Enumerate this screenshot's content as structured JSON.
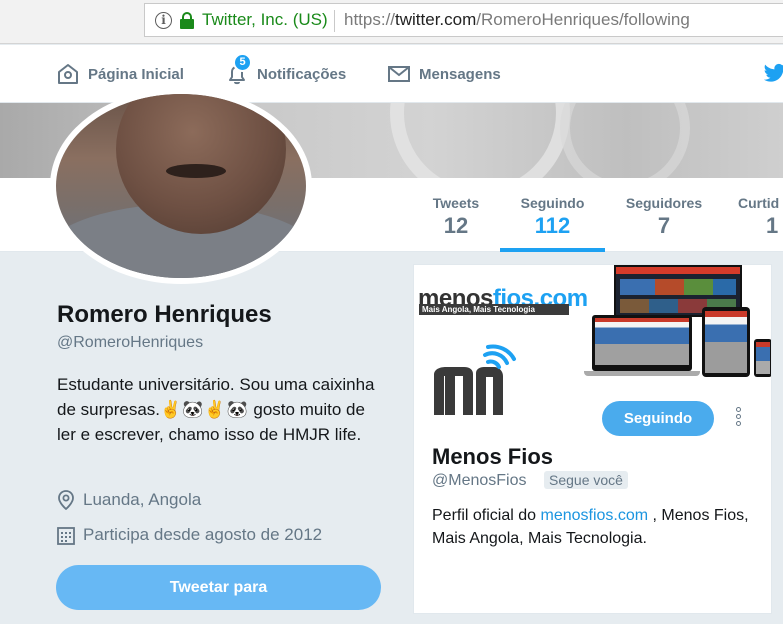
{
  "browser": {
    "site_identity": "Twitter, Inc. (US)",
    "url_prefix": "https://",
    "url_host": "twitter.com",
    "url_path": "/RomeroHenriques/following",
    "info_glyph": "i"
  },
  "topnav": {
    "home_label": "Página Inicial",
    "notifications_label": "Notificações",
    "notifications_count": "5",
    "messages_label": "Mensagens"
  },
  "stats": {
    "tweets_label": "Tweets",
    "tweets_value": "12",
    "following_label": "Seguindo",
    "following_value": "112",
    "followers_label": "Seguidores",
    "followers_value": "7",
    "likes_label": "Curtid",
    "likes_value": "1"
  },
  "profile": {
    "name": "Romero Henriques",
    "handle": "@RomeroHenriques",
    "bio_part1": "Estudante universitário. Sou uma caixinha de surpresas.",
    "bio_emojis": "✌🐼✌🐼",
    "bio_part2": " gosto muito de ler e escrever, chamo isso de HMJR life.",
    "location": "Luanda, Angola",
    "joined": "Participa desde agosto de 2012",
    "tweet_to_label": "Tweetar para"
  },
  "follow_card": {
    "banner_logo_part1": "menos",
    "banner_logo_part2": "fios.com",
    "banner_tagline": "Mais Angola, Mais Tecnologia",
    "following_button": "Seguindo",
    "name": "Menos Fios",
    "handle": "@MenosFios",
    "follows_you": "Segue você",
    "bio_part1": "Perfil oficial do ",
    "bio_link": "menosfios.com",
    "bio_part2": " , Menos Fios, Mais Angola, Mais Tecnologia."
  },
  "colors": {
    "accent": "#1da1f2",
    "secure_green": "#1a8a1a",
    "muted_text": "#657786",
    "page_bg": "#e6ecf0"
  },
  "icons": [
    "info-icon",
    "lock-icon",
    "home-icon",
    "bell-icon",
    "envelope-icon",
    "twitter-bird-icon",
    "location-pin-icon",
    "calendar-icon",
    "more-options-icon"
  ]
}
